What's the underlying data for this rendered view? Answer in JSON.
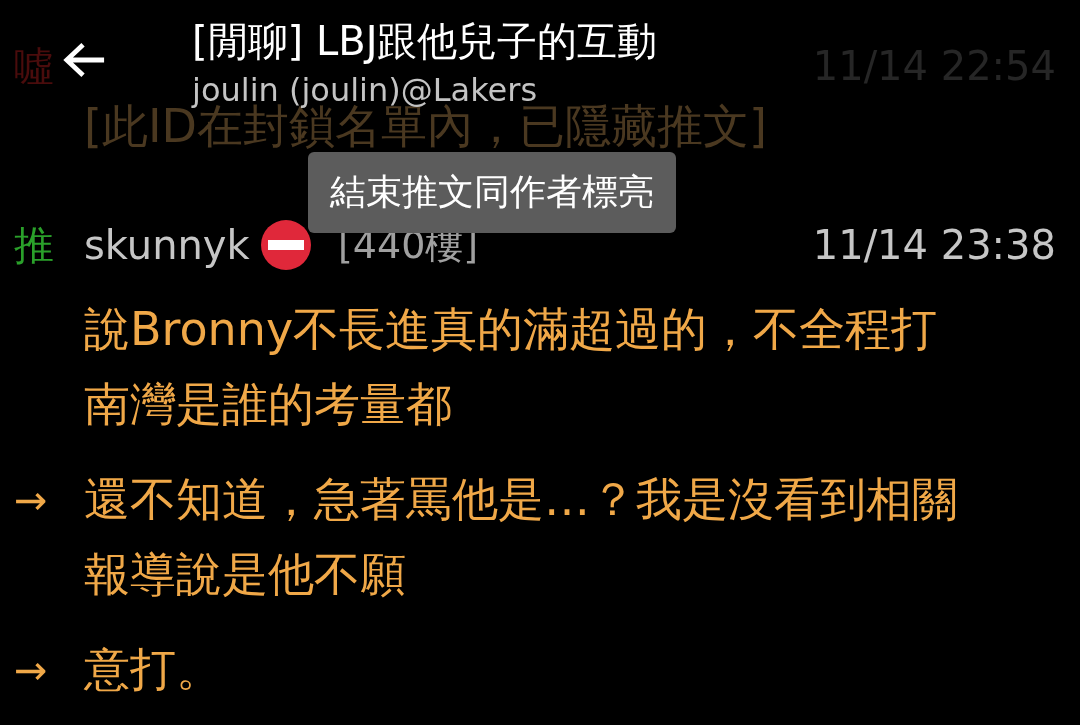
{
  "header": {
    "title": "[閒聊] LBJ跟他兒子的互動",
    "subtitle": "joulin (joulin)@Lakers"
  },
  "comments": [
    {
      "kind": "boo",
      "dimmed": true,
      "tag": "噓",
      "time": "11/14 22:54",
      "lines": [
        "[此ID在封鎖名單內，已隱藏推文]"
      ]
    },
    {
      "kind": "push",
      "dimmed": false,
      "tag": "推",
      "user": "skunnyk",
      "floor": "[440樓]",
      "time": "11/14 23:38",
      "lines": [
        "說Bronny不長進真的滿超過的，不全程打",
        "南灣是誰的考量都"
      ]
    }
  ],
  "replies": [
    {
      "tag": "→",
      "lines": [
        "還不知道，急著罵他是…？我是沒看到相關",
        "報導說是他不願"
      ]
    },
    {
      "tag": "→",
      "lines": [
        "意打。"
      ]
    }
  ],
  "toast": "結束推文同作者標亮"
}
